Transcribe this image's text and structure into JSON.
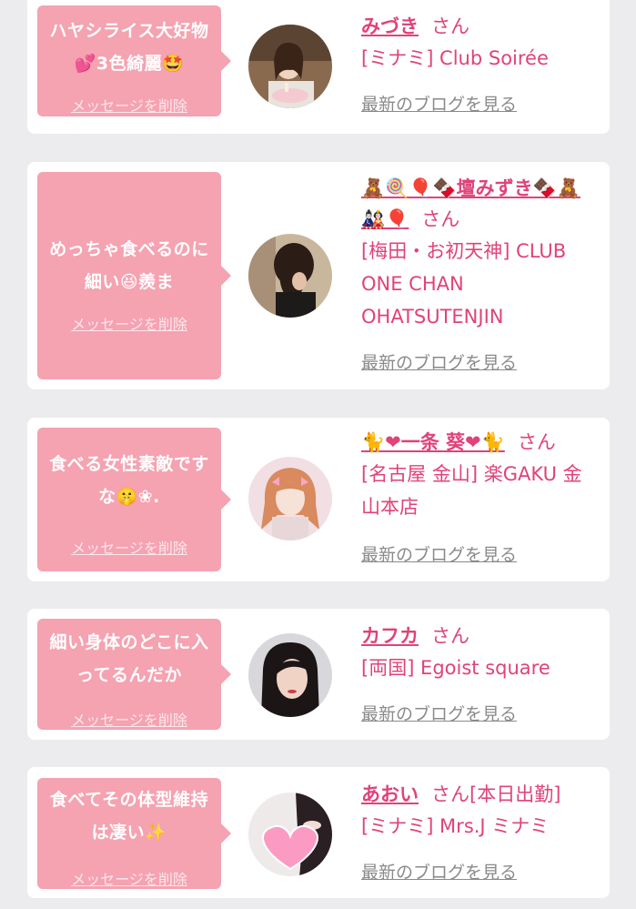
{
  "cards": [
    {
      "message": "ハヤシライス大好物💕3色綺麗🤩",
      "delete_label": "メッセージを削除",
      "name": "みづき",
      "honorific": "さん",
      "shop": "[ミナミ] Club Soirée",
      "blog_label": "最新のブログを見る"
    },
    {
      "message": "めっちゃ食べるのに細い😆羨ま",
      "delete_label": "メッセージを削除",
      "name": "🧸🍭🎈🍫壇みずき🍫🧸🎎🎈",
      "honorific": "さん",
      "shop": "[梅田・お初天神] CLUB ONE CHAN OHATSUTENJIN",
      "blog_label": "最新のブログを見る"
    },
    {
      "message": "食べる女性素敵ですな🤫❀.",
      "delete_label": "メッセージを削除",
      "name": "🐈❤一条 葵❤🐈",
      "honorific": "さん",
      "shop": "[名古屋 金山] 楽GAKU 金山本店",
      "blog_label": "最新のブログを見る"
    },
    {
      "message": "細い身体のどこに入ってるんだか",
      "delete_label": "メッセージを削除",
      "name": "カフカ",
      "honorific": "さん",
      "shop": "[両国] Egoist square",
      "blog_label": "最新のブログを見る"
    },
    {
      "message": "食べてその体型維持は凄い✨",
      "delete_label": "メッセージを削除",
      "name": "あおい",
      "honorific": "さん[本日出勤]",
      "shop": "[ミナミ] Mrs.J ミナミ",
      "blog_label": "最新のブログを見る"
    }
  ],
  "colors": {
    "accent": "#e0427a",
    "bubble": "#f5a2b1",
    "background": "#ececef"
  }
}
